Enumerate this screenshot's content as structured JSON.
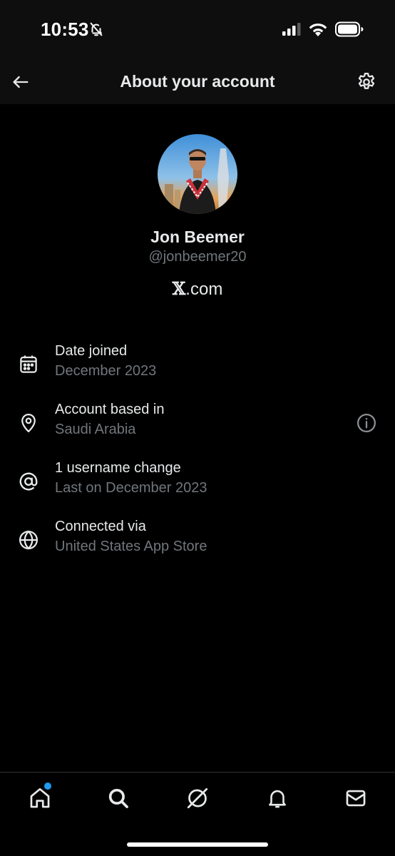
{
  "status_bar": {
    "time": "10:53"
  },
  "header": {
    "title": "About your account"
  },
  "profile": {
    "display_name": "Jon Beemer",
    "handle": "@jonbeemer20",
    "site_logo": "𝕏",
    "site_suffix": ".com"
  },
  "info": [
    {
      "icon": "calendar-icon",
      "title": "Date joined",
      "subtitle": "December 2023"
    },
    {
      "icon": "location-pin-icon",
      "title": "Account based in",
      "subtitle": "Saudi Arabia"
    },
    {
      "icon": "at-sign-icon",
      "title": "1 username change",
      "subtitle": "Last on December 2023"
    },
    {
      "icon": "globe-icon",
      "title": "Connected via",
      "subtitle": "United States App Store"
    }
  ],
  "tabs": [
    {
      "name": "home",
      "icon": "home-icon",
      "has_notification_dot": true
    },
    {
      "name": "search",
      "icon": "search-icon"
    },
    {
      "name": "grok",
      "icon": "grok-icon"
    },
    {
      "name": "notifications",
      "icon": "bell-icon"
    },
    {
      "name": "messages",
      "icon": "envelope-icon"
    }
  ],
  "colors": {
    "background": "#000000",
    "primary_text": "#e7e9ea",
    "secondary_text": "#71767b",
    "accent": "#1d9bf0"
  }
}
